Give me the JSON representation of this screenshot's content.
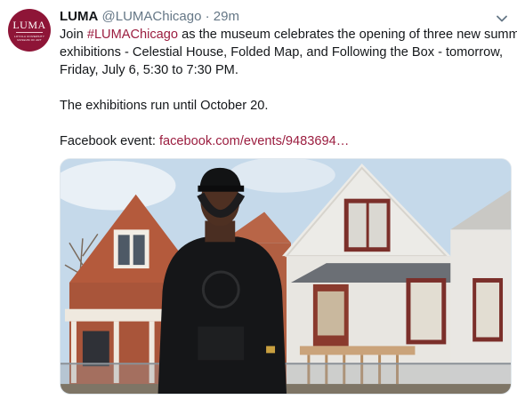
{
  "avatar": {
    "logo_word": "LUMA",
    "logo_subtext": "LOYOLA UNIVERSITY MUSEUM OF ART"
  },
  "tweet": {
    "display_name": "LUMA",
    "handle": "@LUMAChicago",
    "separator": "·",
    "timestamp": "29m",
    "line1_prefix": "Join ",
    "hashtag": "#LUMAChicago",
    "line1_suffix": " as the museum celebrates the opening of three new summer",
    "line2": "exhibitions - Celestial House, Folded Map, and Following the Box - tomorrow,",
    "line3": "Friday, July 6, 5:30 to 7:30 PM.",
    "line4": "The exhibitions run until October 20.",
    "fb_label": "Facebook event: ",
    "fb_link": "facebook.com/events/9483694…"
  },
  "colors": {
    "brand": "#8e1537",
    "link": "#9b1d3f",
    "muted": "#657786"
  },
  "icons": {
    "menu": "chevron-down-icon"
  }
}
